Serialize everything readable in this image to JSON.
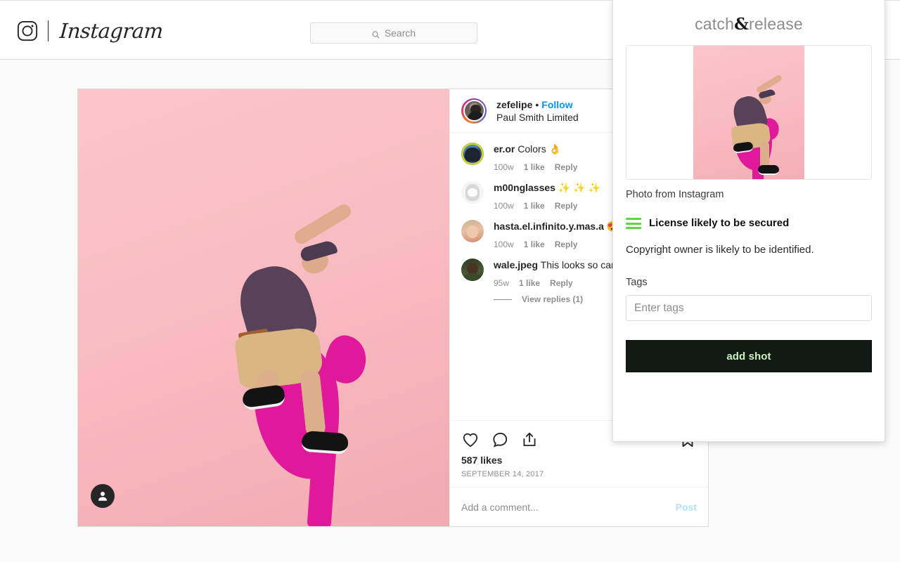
{
  "browser": {
    "site": "Instagram"
  },
  "ig_header": {
    "logo_icon": "instagram-camera-icon",
    "wordmark": "Instagram",
    "search": {
      "icon": "search-icon",
      "placeholder": "Search",
      "value": ""
    }
  },
  "post": {
    "photo": {
      "alt": "Man jumping in front of a pink wall",
      "badge_icon": "tagged-people-icon",
      "bg_color": "#f9bfc4",
      "shadow_color": "#e0189a"
    },
    "header": {
      "avatar": "user-avatar",
      "username": "zefelipe",
      "separator": "•",
      "follow_label": "Follow",
      "location": "Paul Smith Limited"
    },
    "comments": [
      {
        "avatar": "commenter-avatar-1",
        "username": "er.or",
        "text": "Colors 👌",
        "time": "100w",
        "likes": "1 like",
        "reply": "Reply"
      },
      {
        "avatar": "commenter-avatar-2",
        "username": "m00nglasses",
        "text": "✨ ✨ ✨",
        "time": "100w",
        "likes": "1 like",
        "reply": "Reply"
      },
      {
        "avatar": "commenter-avatar-3",
        "username": "hasta.el.infinito.y.mas.a",
        "text": "😍 😍",
        "time": "100w",
        "likes": "1 like",
        "reply": "Reply"
      },
      {
        "avatar": "commenter-avatar-4",
        "username": "wale.jpeg",
        "text": "This looks so camera do you use?",
        "time": "95w",
        "likes": "1 like",
        "reply": "Reply",
        "view_replies": "View replies (1)"
      }
    ],
    "actions": {
      "like_icon": "heart-icon",
      "comment_icon": "comment-bubble-icon",
      "share_icon": "share-icon",
      "save_icon": "bookmark-icon",
      "likes": "587 likes",
      "date": "SEPTEMBER 14, 2017"
    },
    "add_comment": {
      "placeholder": "Add a comment...",
      "value": "",
      "post_label": "Post"
    }
  },
  "extension": {
    "logo": {
      "part1": "catch",
      "amp": "&",
      "part2": "release"
    },
    "thumbnail_caption": "Photo from Instagram",
    "status": {
      "icon": "license-bars-icon",
      "icon_color": "#5ed63f",
      "label": "License likely to be secured"
    },
    "description": "Copyright owner is likely to be identified.",
    "tags": {
      "label": "Tags",
      "placeholder": "Enter tags",
      "value": ""
    },
    "submit_label": "add shot",
    "submit_bg": "#121a14",
    "submit_color": "#cdf0c0"
  }
}
